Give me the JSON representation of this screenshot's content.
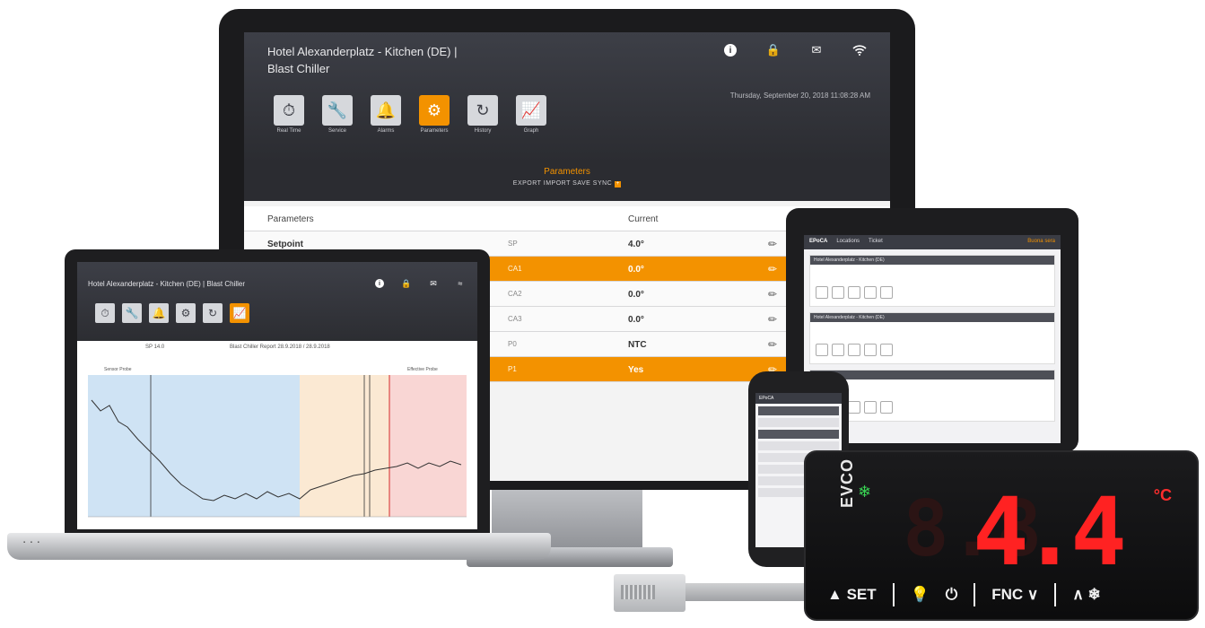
{
  "monitor": {
    "title_line1": "Hotel Alexanderplatz - Kitchen (DE) |",
    "title_line2": "Blast Chiller",
    "datetime": "Thursday, September 20, 2018 11:08:28 AM",
    "header_icons": [
      "info-icon",
      "lock-icon",
      "mail-icon",
      "wifi-icon"
    ],
    "nav": [
      {
        "label": "Real Time",
        "icon": "stopwatch-icon"
      },
      {
        "label": "Service",
        "icon": "wrench-icon"
      },
      {
        "label": "Alarms",
        "icon": "bell-icon"
      },
      {
        "label": "Parameters",
        "icon": "gear-icon",
        "active": true
      },
      {
        "label": "History",
        "icon": "history-icon"
      },
      {
        "label": "Graph",
        "icon": "graph-icon"
      }
    ],
    "section_title": "Parameters",
    "actions": "EXPORT   IMPORT   SAVE   SYNC",
    "table": {
      "headers": [
        "Parameters",
        "Current"
      ],
      "rows": [
        {
          "name": "Setpoint",
          "code": "SP",
          "value": "4.0°"
        },
        {
          "name": "",
          "code": "CA1",
          "value": "0.0°"
        },
        {
          "name": "",
          "code": "CA2",
          "value": "0.0°"
        },
        {
          "name": "",
          "code": "CA3",
          "value": "0.0°"
        },
        {
          "name": "",
          "code": "P0",
          "value": "NTC"
        },
        {
          "name": "",
          "code": "P1",
          "value": "Yes"
        }
      ]
    }
  },
  "laptop": {
    "title": "Hotel Alexanderplatz - Kitchen (DE) | Blast Chiller",
    "chart_left": "SP 14.0",
    "chart_title": "Blast Chiller Report 28.9.2018 / 28.9.2018",
    "legend_left": "Sensor Probe",
    "legend_right": "Effective Probe",
    "nav": [
      "Real Time",
      "Service",
      "Alarms",
      "Parameters",
      "History",
      "Graph"
    ]
  },
  "tablet": {
    "brand": "EPoCA",
    "menu": [
      "Locations",
      "Ticket"
    ],
    "right": "Buona sera",
    "sections": [
      "Hotel Alexanderplatz - Kitchen (DE)",
      "Hotel Alexanderplatz - Kitchen (DE)"
    ]
  },
  "phone": {
    "brand": "EPoCA"
  },
  "controller": {
    "brand": "EVCO",
    "temperature": "4.4",
    "ghost": "8.8",
    "unit": "°C",
    "buttons": [
      "SET",
      "FNC"
    ]
  }
}
